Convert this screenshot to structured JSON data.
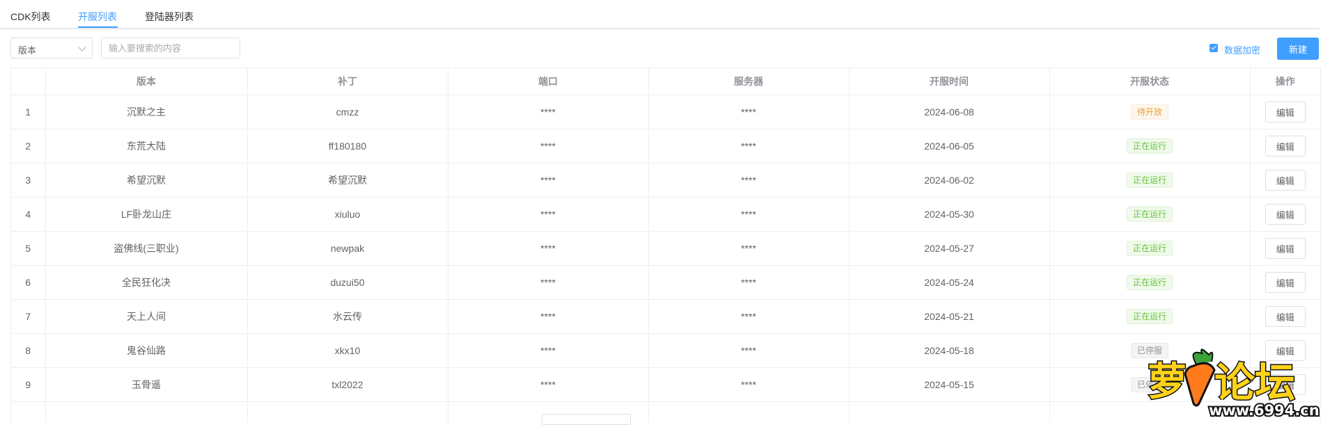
{
  "tabs": [
    {
      "label": "CDK列表"
    },
    {
      "label": "开服列表"
    },
    {
      "label": "登陆器列表"
    }
  ],
  "active_tab": 1,
  "toolbar": {
    "version_select": "版本",
    "search_placeholder": "输入要搜索的内容",
    "encrypt_label": "数据加密",
    "encrypt_checked": true,
    "new_button": "新建"
  },
  "table": {
    "headers": [
      "",
      "版本",
      "补丁",
      "端口",
      "服务器",
      "开服时间",
      "开服状态",
      "操作"
    ],
    "rows": [
      {
        "index": "1",
        "version": "沉默之主",
        "patch": "cmzz",
        "port": "****",
        "server": "****",
        "open_date": "2024-06-08",
        "status": "待开放",
        "status_type": "pending",
        "action": "编辑"
      },
      {
        "index": "2",
        "version": "东荒大陆",
        "patch": "ff180180",
        "port": "****",
        "server": "****",
        "open_date": "2024-06-05",
        "status": "正在运行",
        "status_type": "running",
        "action": "编辑"
      },
      {
        "index": "3",
        "version": "希望沉默",
        "patch": "希望沉默",
        "port": "****",
        "server": "****",
        "open_date": "2024-06-02",
        "status": "正在运行",
        "status_type": "running",
        "action": "编辑"
      },
      {
        "index": "4",
        "version": "LF卧龙山庄",
        "patch": "xiuluo",
        "port": "****",
        "server": "****",
        "open_date": "2024-05-30",
        "status": "正在运行",
        "status_type": "running",
        "action": "编辑"
      },
      {
        "index": "5",
        "version": "盗佛线(三职业)",
        "patch": "newpak",
        "port": "****",
        "server": "****",
        "open_date": "2024-05-27",
        "status": "正在运行",
        "status_type": "running",
        "action": "编辑"
      },
      {
        "index": "6",
        "version": "全民狂化决",
        "patch": "duzui50",
        "port": "****",
        "server": "****",
        "open_date": "2024-05-24",
        "status": "正在运行",
        "status_type": "running",
        "action": "编辑"
      },
      {
        "index": "7",
        "version": "天上人间",
        "patch": "水云传",
        "port": "****",
        "server": "****",
        "open_date": "2024-05-21",
        "status": "正在运行",
        "status_type": "running",
        "action": "编辑"
      },
      {
        "index": "8",
        "version": "鬼谷仙路",
        "patch": "xkx10",
        "port": "****",
        "server": "****",
        "open_date": "2024-05-18",
        "status": "已停服",
        "status_type": "stopped",
        "action": "编辑"
      },
      {
        "index": "9",
        "version": "玉骨遥",
        "patch": "txl2022",
        "port": "****",
        "server": "****",
        "open_date": "2024-05-15",
        "status": "已停服",
        "status_type": "stopped",
        "action": "编辑"
      },
      {
        "index": "",
        "version": "",
        "patch": "",
        "port": "",
        "server": "",
        "open_date": "",
        "status": "",
        "status_type": "",
        "action": ""
      }
    ]
  },
  "watermark": {
    "title": "萝卜论坛",
    "url": "www.6994.cn"
  },
  "colors": {
    "accent": "#409eff",
    "pending": "#e6a23c",
    "running": "#67c23a",
    "stopped": "#909399"
  }
}
